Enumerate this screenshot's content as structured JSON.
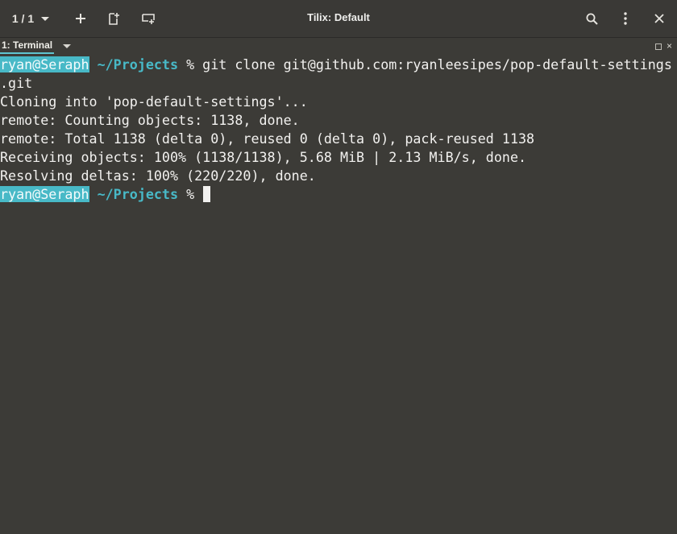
{
  "header": {
    "session_label": "1 / 1",
    "title": "Tilix: Default",
    "icons": {
      "add": "plus-icon",
      "add_right": "split-right-icon",
      "add_down": "split-down-icon",
      "search": "search-icon",
      "menu": "kebab-menu-icon",
      "close": "close-icon"
    }
  },
  "terminal_tab": {
    "label": "1: Terminal"
  },
  "colors": {
    "accent": "#48b9c7",
    "background": "#3c3b37",
    "text": "#f2f1ef"
  },
  "terminal": {
    "prompt_user": "ryan@Seraph",
    "prompt_path": "~/Projects",
    "prompt_symbol": "%",
    "command": "git clone git@github.com:ryanleesipes/pop-default-settings",
    "command_wrap": ".git",
    "output": [
      "Cloning into 'pop-default-settings'...",
      "remote: Counting objects: 1138, done.",
      "remote: Total 1138 (delta 0), reused 0 (delta 0), pack-reused 1138",
      "Receiving objects: 100% (1138/1138), 5.68 MiB | 2.13 MiB/s, done.",
      "Resolving deltas: 100% (220/220), done."
    ]
  }
}
